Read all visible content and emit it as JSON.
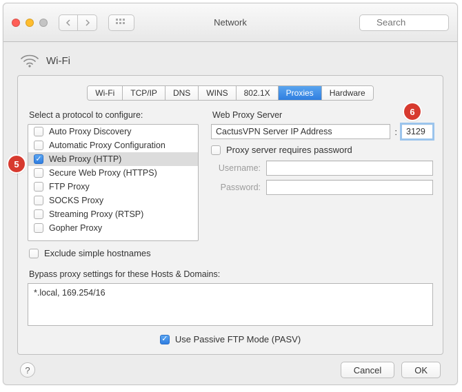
{
  "window": {
    "title": "Network",
    "search_placeholder": "Search"
  },
  "header": {
    "interface_name": "Wi-Fi"
  },
  "tabs": [
    {
      "label": "Wi-Fi"
    },
    {
      "label": "TCP/IP"
    },
    {
      "label": "DNS"
    },
    {
      "label": "WINS"
    },
    {
      "label": "802.1X"
    },
    {
      "label": "Proxies",
      "active": true
    },
    {
      "label": "Hardware"
    }
  ],
  "left": {
    "section_label": "Select a protocol to configure:",
    "protocols": [
      {
        "label": "Auto Proxy Discovery",
        "checked": false
      },
      {
        "label": "Automatic Proxy Configuration",
        "checked": false
      },
      {
        "label": "Web Proxy (HTTP)",
        "checked": true,
        "selected": true
      },
      {
        "label": "Secure Web Proxy (HTTPS)",
        "checked": false
      },
      {
        "label": "FTP Proxy",
        "checked": false
      },
      {
        "label": "SOCKS Proxy",
        "checked": false
      },
      {
        "label": "Streaming Proxy (RTSP)",
        "checked": false
      },
      {
        "label": "Gopher Proxy",
        "checked": false
      }
    ],
    "exclude_label": "Exclude simple hostnames"
  },
  "right": {
    "section_label": "Web Proxy Server",
    "server_value": "CactusVPN Server IP Address",
    "port_value": "3129",
    "requires_password_label": "Proxy server requires password",
    "username_label": "Username:",
    "password_label": "Password:"
  },
  "bypass": {
    "label": "Bypass proxy settings for these Hosts & Domains:",
    "value": "*.local, 169.254/16"
  },
  "pasv_label": "Use Passive FTP Mode (PASV)",
  "footer": {
    "cancel": "Cancel",
    "ok": "OK"
  },
  "callouts": {
    "five": "5",
    "six": "6"
  }
}
